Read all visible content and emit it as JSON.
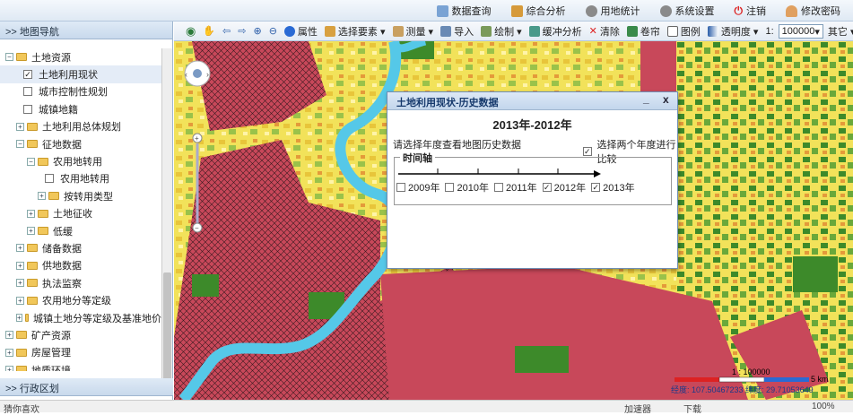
{
  "topnav": {
    "items": [
      {
        "label": "数据查询"
      },
      {
        "label": "综合分析"
      },
      {
        "label": "用地统计"
      },
      {
        "label": "系统设置"
      },
      {
        "label": "注销"
      },
      {
        "label": "修改密码"
      }
    ]
  },
  "sidebar": {
    "title": ">> 地图导航",
    "admin_title": ">> 行政区划",
    "tree": [
      {
        "label": "土地资源",
        "expander": "⊟",
        "folder": true,
        "indent": 0
      },
      {
        "label": "土地利用现状",
        "checkbox": "checked",
        "indent": 1,
        "selected": true
      },
      {
        "label": "城市控制性规划",
        "checkbox": "unchecked",
        "indent": 1
      },
      {
        "label": "城镇地籍",
        "checkbox": "unchecked",
        "indent": 1
      },
      {
        "label": "土地利用总体规划",
        "expander": "⊞",
        "folder": true,
        "indent": 1
      },
      {
        "label": "征地数据",
        "expander": "⊟",
        "folder": true,
        "indent": 1
      },
      {
        "label": "农用地转用",
        "expander": "⊟",
        "folder": true,
        "indent": 2
      },
      {
        "label": "农用地转用",
        "checkbox": "unchecked",
        "indent": 3
      },
      {
        "label": "按转用类型",
        "expander": "⊞",
        "folder": true,
        "indent": 3
      },
      {
        "label": "土地征收",
        "expander": "⊞",
        "folder": true,
        "indent": 2
      },
      {
        "label": "低缓",
        "expander": "⊞",
        "folder": true,
        "indent": 2
      },
      {
        "label": "储备数据",
        "expander": "⊞",
        "folder": true,
        "indent": 1
      },
      {
        "label": "供地数据",
        "expander": "⊞",
        "folder": true,
        "indent": 1
      },
      {
        "label": "执法监察",
        "expander": "⊞",
        "folder": true,
        "indent": 1
      },
      {
        "label": "农用地分等定级",
        "expander": "⊞",
        "folder": true,
        "indent": 1
      },
      {
        "label": "城镇土地分等定级及基准地价",
        "expander": "⊞",
        "folder": true,
        "indent": 1
      },
      {
        "label": "矿产资源",
        "expander": "⊞",
        "folder": true,
        "indent": 0
      },
      {
        "label": "房屋管理",
        "expander": "⊞",
        "folder": true,
        "indent": 0
      },
      {
        "label": "地质环境",
        "expander": "⊞",
        "folder": true,
        "indent": 0
      }
    ]
  },
  "toolbar": {
    "items": [
      {
        "label": "属性"
      },
      {
        "label": "选择要素 ▾"
      },
      {
        "label": "测量 ▾"
      },
      {
        "label": "导入"
      },
      {
        "label": "绘制 ▾"
      },
      {
        "label": "缓冲分析"
      },
      {
        "label": "清除"
      },
      {
        "label": "卷帘"
      },
      {
        "label": "图例"
      },
      {
        "label": "透明度 ▾"
      }
    ],
    "scale_prefix": "1:",
    "scale_value": "100000",
    "other_label": "其它 ▾"
  },
  "dialog": {
    "title": "土地利用现状-历史数据",
    "heading": "2013年-2012年",
    "instruction": "请选择年度查看地图历史数据",
    "compare_label": "选择两个年度进行比较",
    "compare_checked": true,
    "timeline_label": "时间轴",
    "years": [
      {
        "label": "2009年",
        "checked": false
      },
      {
        "label": "2010年",
        "checked": false
      },
      {
        "label": "2011年",
        "checked": false
      },
      {
        "label": "2012年",
        "checked": true
      },
      {
        "label": "2013年",
        "checked": true
      }
    ]
  },
  "map": {
    "scale_label": "1 : 100000",
    "scale_km": "5 km",
    "coords": "经度: 107.50467233 纬度: 29.71053649"
  },
  "statusbar": {
    "left": "猜你喜欢",
    "accelerator": "加速器",
    "download": "下载",
    "zoom": "100%"
  },
  "colors": {
    "urban_red": "#c8485a",
    "river": "#55c8e8",
    "farmland_yellow": "#f2e25a",
    "forest_green": "#3d8a2a"
  }
}
